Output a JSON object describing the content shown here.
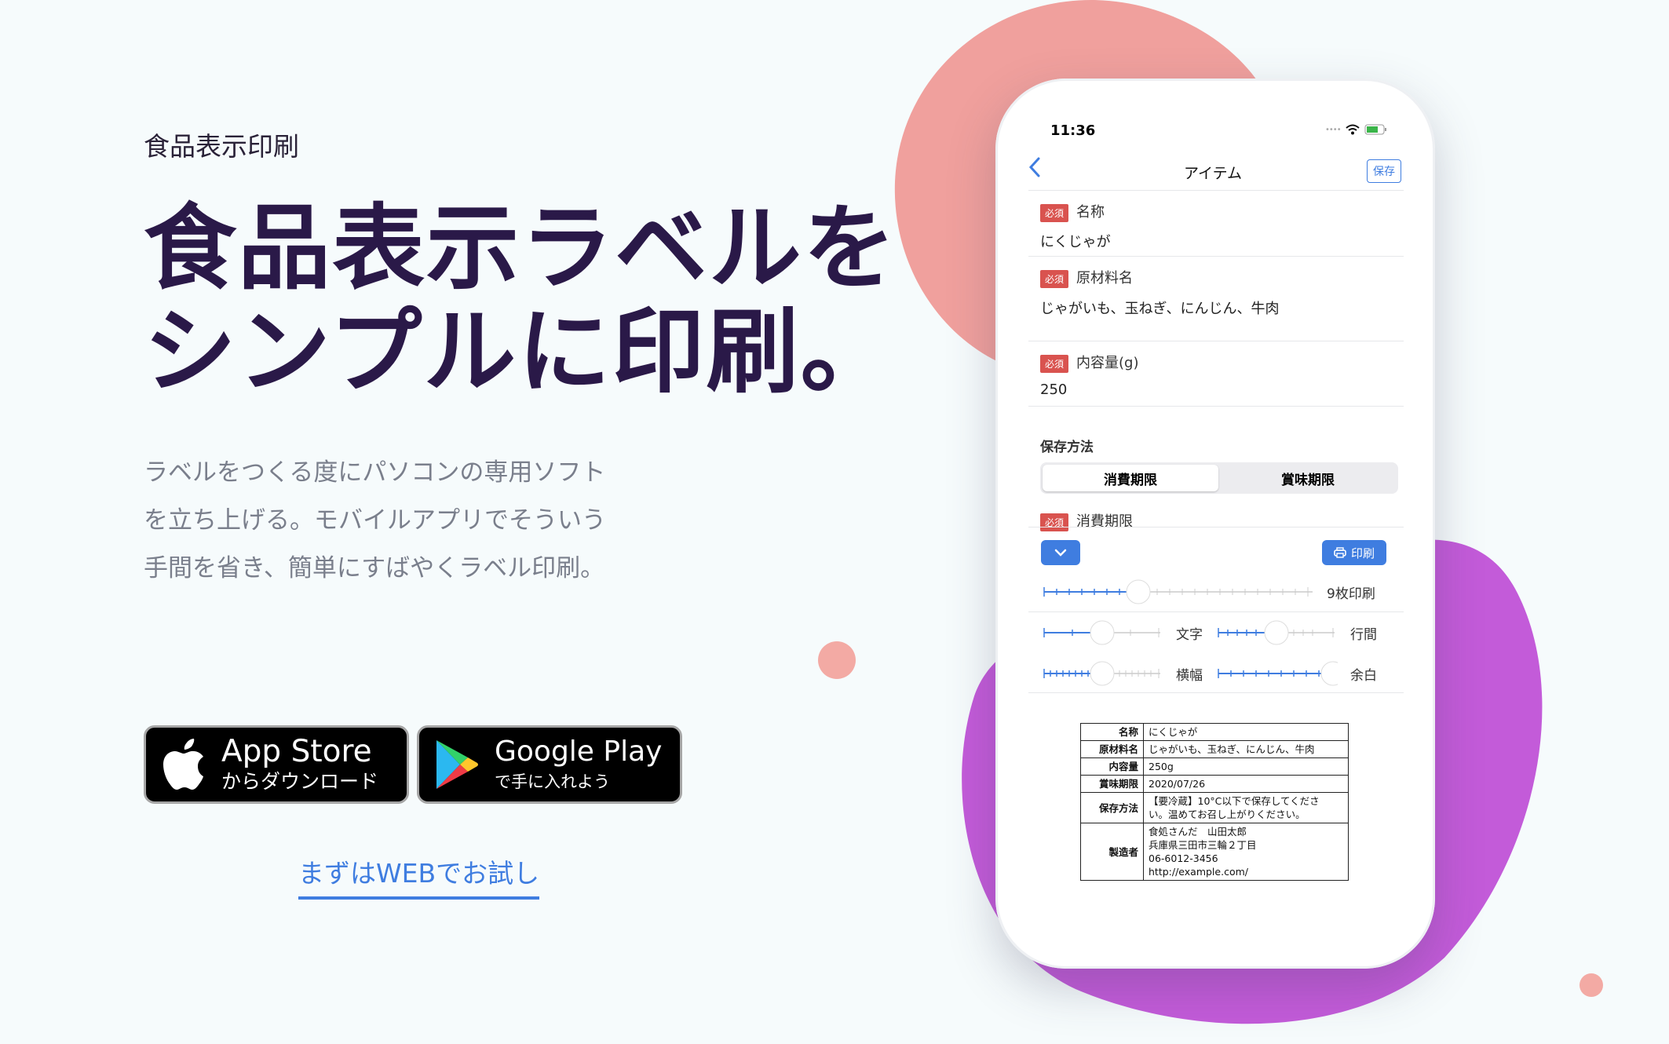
{
  "hero": {
    "eyebrow": "食品表示印刷",
    "title": "食品表示ラベルを\nシンプルに印刷。",
    "description": "ラベルをつくる度にパソコンの専用ソフトを立ち上げる。モバイルアプリでそういう手間を省き、簡単にすばやくラベル印刷。"
  },
  "stores": {
    "apple": {
      "big": "App Store",
      "small": "からダウンロード",
      "icon": "apple-logo"
    },
    "google": {
      "big": "Google Play",
      "small": "で手に入れよう",
      "icon": "google-play-logo"
    }
  },
  "web_link": "まずはWEBでお試し",
  "phone": {
    "status_time": "11:36",
    "nav": {
      "title": "アイテム",
      "save": "保存"
    },
    "required_badge": "必須",
    "fields": {
      "name_label": "名称",
      "name_value": "にくじゃが",
      "ingredients_label": "原材料名",
      "ingredients_value": "じゃがいも、玉ねぎ、にんじん、牛肉",
      "content_label": "内容量(g)",
      "content_value": "250"
    },
    "storage_label": "保存方法",
    "segment": [
      "消費期限",
      "賞味期限"
    ],
    "expiry_label": "消費期限",
    "print_button": "印刷",
    "print_count": "9枚印刷",
    "sliders": {
      "text": "文字",
      "line_spacing": "行間",
      "width": "横幅",
      "margin": "余白"
    },
    "label_table": [
      {
        "key": "名称",
        "value": [
          "にくじゃが"
        ]
      },
      {
        "key": "原材料名",
        "value": [
          "じゃがいも、玉ねぎ、にんじん、牛肉"
        ]
      },
      {
        "key": "内容量",
        "value": [
          "250g"
        ]
      },
      {
        "key": "賞味期限",
        "value": [
          "2020/07/26"
        ]
      },
      {
        "key": "保存方法",
        "value": [
          "【要冷蔵】10°C以下で保存してくださ",
          "い。温めてお召し上がりください。"
        ]
      },
      {
        "key": "製造者",
        "value": [
          "食処さんだ　山田太郎",
          "兵庫県三田市三輪２丁目",
          "06-6012-3456",
          "http://example.com/"
        ]
      }
    ]
  },
  "colors": {
    "accent": "#3f7de0",
    "title": "#2a1948",
    "blob_pink": "#f0a09d",
    "blob_purple": "#c35bd9",
    "required": "#d9534f"
  }
}
